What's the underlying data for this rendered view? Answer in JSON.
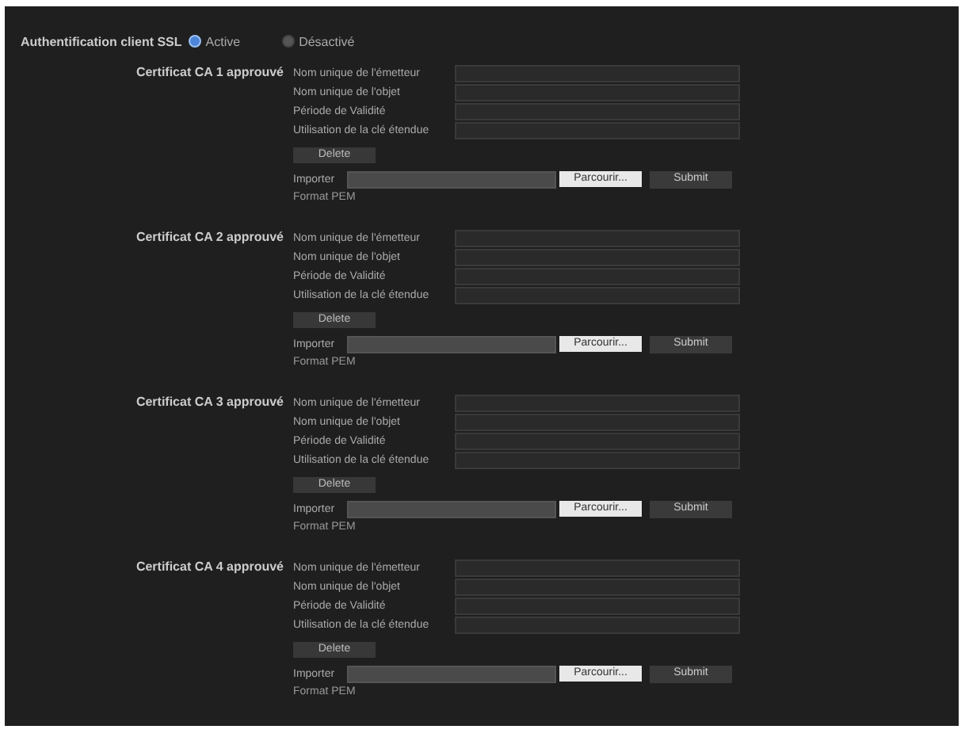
{
  "header": {
    "label": "Authentification client SSL",
    "options": [
      {
        "label": "Active",
        "selected": true
      },
      {
        "label": "Désactivé",
        "selected": false
      }
    ]
  },
  "certificates": [
    {
      "title": "Certificat CA 1 approuvé",
      "fields": [
        "Nom unique de l'émetteur",
        "Nom unique de l'objet",
        "Période de Validité",
        "Utilisation de la clé étendue"
      ],
      "delete": "Delete",
      "import_label": "Importer",
      "browse": "Parcourir...",
      "submit": "Submit",
      "format": "Format PEM"
    },
    {
      "title": "Certificat CA 2 approuvé",
      "fields": [
        "Nom unique de l'émetteur",
        "Nom unique de l'objet",
        "Période de Validité",
        "Utilisation de la clé étendue"
      ],
      "delete": "Delete",
      "import_label": "Importer",
      "browse": "Parcourir...",
      "submit": "Submit",
      "format": "Format PEM"
    },
    {
      "title": "Certificat CA 3 approuvé",
      "fields": [
        "Nom unique de l'émetteur",
        "Nom unique de l'objet",
        "Période de Validité",
        "Utilisation de la clé étendue"
      ],
      "delete": "Delete",
      "import_label": "Importer",
      "browse": "Parcourir...",
      "submit": "Submit",
      "format": "Format PEM"
    },
    {
      "title": "Certificat CA 4 approuvé",
      "fields": [
        "Nom unique de l'émetteur",
        "Nom unique de l'objet",
        "Période de Validité",
        "Utilisation de la clé étendue"
      ],
      "delete": "Delete",
      "import_label": "Importer",
      "browse": "Parcourir...",
      "submit": "Submit",
      "format": "Format PEM"
    }
  ]
}
